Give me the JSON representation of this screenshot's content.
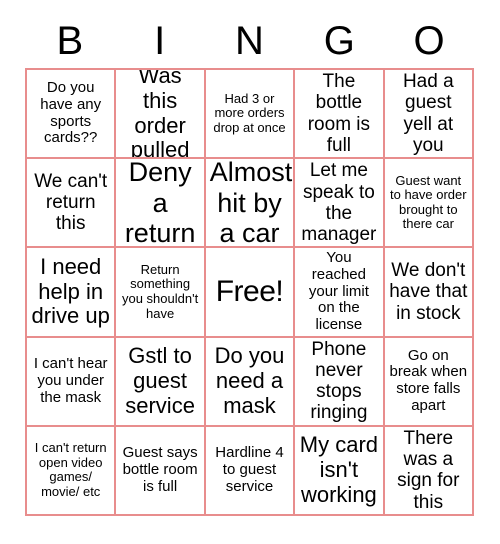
{
  "header": {
    "letters": [
      "B",
      "I",
      "N",
      "G",
      "O"
    ]
  },
  "colors": {
    "border": "#e88d8d",
    "text": "#000000",
    "background": "#ffffff"
  },
  "grid": {
    "rows": 5,
    "columns": 5,
    "cells": [
      {
        "text": "Do you have any sports cards??",
        "size": "sm"
      },
      {
        "text": "Was this order pulled",
        "size": "lg"
      },
      {
        "text": "Had 3 or more orders drop at once",
        "size": "xs"
      },
      {
        "text": "The bottle room is full",
        "size": "md"
      },
      {
        "text": "Had a guest yell at you",
        "size": "md"
      },
      {
        "text": "We can't return this",
        "size": "md"
      },
      {
        "text": "Deny a return",
        "size": "xl"
      },
      {
        "text": "Almost hit by a car",
        "size": "xl"
      },
      {
        "text": "Let me speak to the manager",
        "size": "md"
      },
      {
        "text": "Guest want to have order brought to there car",
        "size": "xs"
      },
      {
        "text": "I need help in drive up",
        "size": "lg"
      },
      {
        "text": "Return something you shouldn't have",
        "size": "xs"
      },
      {
        "text": "Free!",
        "size": "free"
      },
      {
        "text": "You reached your limit on the license",
        "size": "sm"
      },
      {
        "text": "We don't have that in stock",
        "size": "md"
      },
      {
        "text": "I can't hear you under the mask",
        "size": "sm"
      },
      {
        "text": "Gstl to guest service",
        "size": "lg"
      },
      {
        "text": "Do you need a mask",
        "size": "lg"
      },
      {
        "text": "Phone never stops ringing",
        "size": "md"
      },
      {
        "text": "Go on break when store falls apart",
        "size": "sm"
      },
      {
        "text": "I can't return open video games/ movie/ etc",
        "size": "xs"
      },
      {
        "text": "Guest says bottle room is full",
        "size": "sm"
      },
      {
        "text": "Hardline 4 to guest service",
        "size": "sm"
      },
      {
        "text": "My card isn't working",
        "size": "lg"
      },
      {
        "text": "There was a sign for this",
        "size": "md"
      }
    ]
  }
}
